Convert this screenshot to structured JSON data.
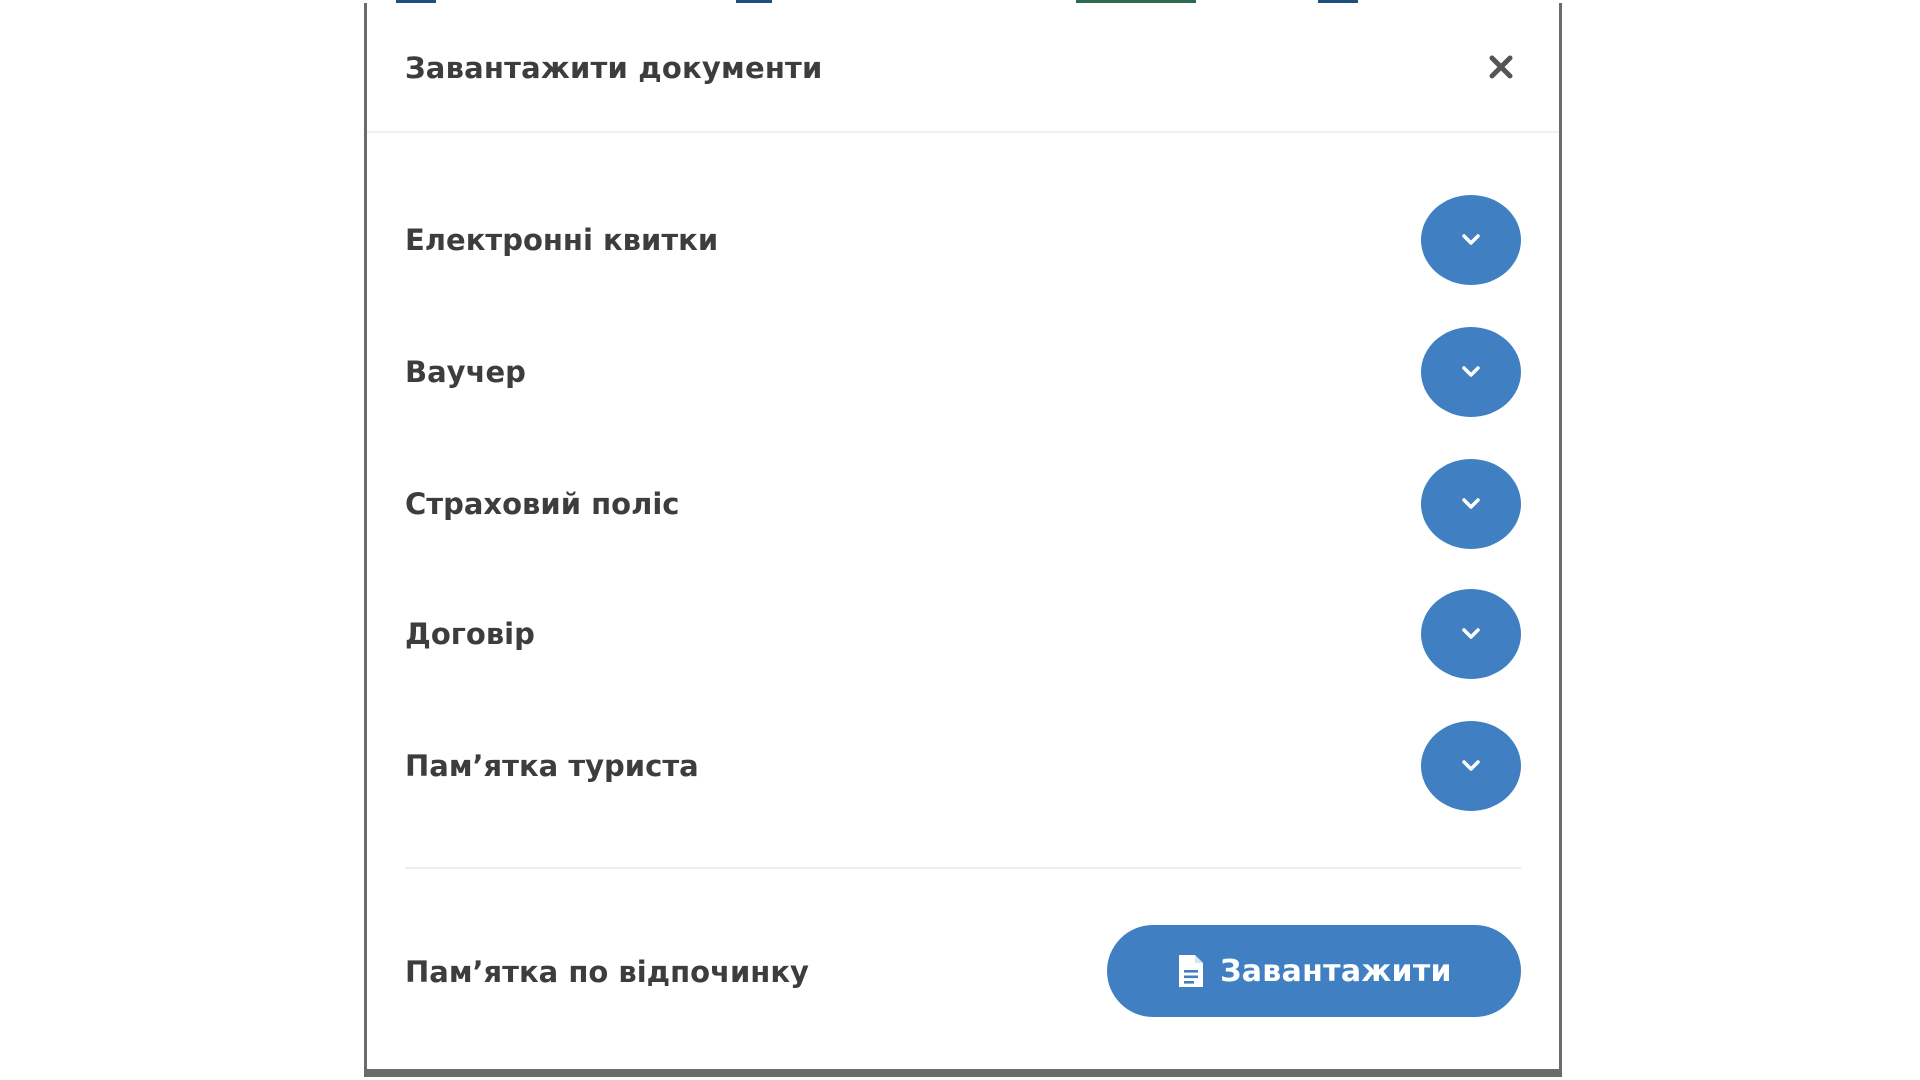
{
  "modal": {
    "title": "Завантажити документи",
    "close_icon": "close-icon"
  },
  "documents": [
    {
      "label": "Електронні квитки",
      "icon": "chevron-down-icon"
    },
    {
      "label": "Ваучер",
      "icon": "chevron-down-icon"
    },
    {
      "label": "Страховий поліс",
      "icon": "chevron-down-icon"
    },
    {
      "label": "Договір",
      "icon": "chevron-down-icon"
    },
    {
      "label": "Пам’ятка туриста",
      "icon": "chevron-down-icon"
    }
  ],
  "footer": {
    "label": "Пам’ятка по відпочинку",
    "download_label": "Завантажити",
    "download_icon": "document-icon"
  },
  "colors": {
    "accent": "#3f7fc2",
    "text": "#3d3d3d",
    "modal_border": "#6b6b6b"
  }
}
